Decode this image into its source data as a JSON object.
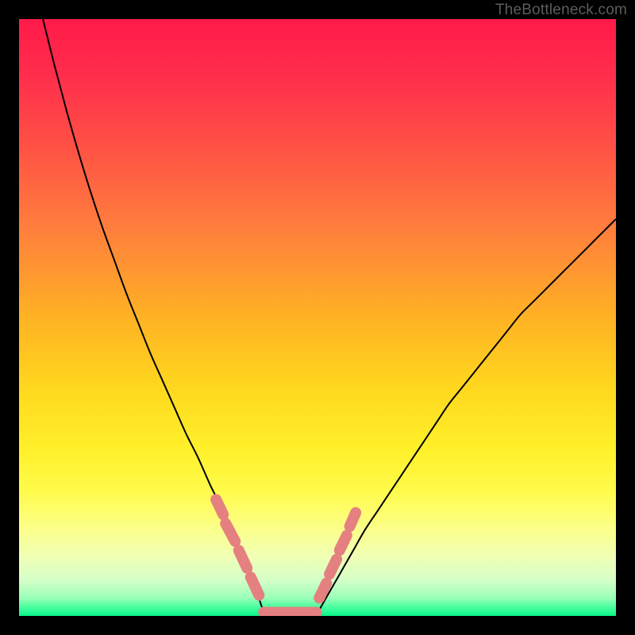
{
  "watermark": "TheBottleneck.com",
  "chart_data": {
    "type": "line",
    "title": "",
    "xlabel": "",
    "ylabel": "",
    "xlim": [
      0,
      100
    ],
    "ylim": [
      0,
      100
    ],
    "grid": false,
    "legend": false,
    "series": [
      {
        "name": "curve-left-branch",
        "stroke": "#000000",
        "stroke_width": 2,
        "x": [
          4,
          6,
          8,
          10,
          12,
          14,
          16,
          18,
          20,
          22,
          24,
          26,
          28,
          30,
          32,
          33,
          34,
          35,
          36,
          37,
          38,
          39,
          40,
          41
        ],
        "y": [
          100,
          92,
          84.5,
          77.5,
          71,
          65,
          59.5,
          54,
          49,
          44,
          39.5,
          35,
          30.5,
          26.5,
          22,
          20,
          18,
          16,
          13.5,
          11,
          8.5,
          6,
          3.5,
          0.5
        ]
      },
      {
        "name": "curve-right-branch",
        "stroke": "#000000",
        "stroke_width": 2,
        "x": [
          50,
          52,
          54,
          56,
          58,
          60,
          62,
          64,
          66,
          68,
          70,
          72,
          74,
          76,
          78,
          80,
          82,
          84,
          86,
          88,
          90,
          92,
          94,
          96,
          98,
          100
        ],
        "y": [
          0.5,
          4,
          7.5,
          11,
          14.5,
          17.5,
          20.5,
          23.5,
          26.5,
          29.5,
          32.5,
          35.5,
          38,
          40.5,
          43,
          45.5,
          48,
          50.5,
          52.5,
          54.5,
          56.5,
          58.5,
          60.5,
          62.5,
          64.5,
          66.5
        ]
      },
      {
        "name": "pink-dashes-left",
        "stroke": "#e58080",
        "stroke_width": 14,
        "linecap": "round",
        "segments": [
          {
            "x1": 33.0,
            "y1": 19.5,
            "x2": 34.2,
            "y2": 17.0
          },
          {
            "x1": 34.6,
            "y1": 15.5,
            "x2": 36.2,
            "y2": 12.5
          },
          {
            "x1": 36.8,
            "y1": 11.0,
            "x2": 38.2,
            "y2": 8.0
          },
          {
            "x1": 38.8,
            "y1": 6.5,
            "x2": 40.2,
            "y2": 3.5
          }
        ]
      },
      {
        "name": "pink-dashes-right",
        "stroke": "#e58080",
        "stroke_width": 14,
        "linecap": "round",
        "segments": [
          {
            "x1": 50.3,
            "y1": 3.0,
            "x2": 51.5,
            "y2": 5.5
          },
          {
            "x1": 52.0,
            "y1": 7.0,
            "x2": 53.2,
            "y2": 9.5
          },
          {
            "x1": 53.7,
            "y1": 11.0,
            "x2": 54.9,
            "y2": 13.5
          },
          {
            "x1": 55.4,
            "y1": 15.0,
            "x2": 56.4,
            "y2": 17.3
          }
        ]
      },
      {
        "name": "pink-flat-bottom",
        "stroke": "#e58080",
        "stroke_width": 14,
        "linecap": "round",
        "segments": [
          {
            "x1": 41.0,
            "y1": 0.6,
            "x2": 49.8,
            "y2": 0.6
          }
        ]
      }
    ],
    "background_gradient": {
      "type": "vertical",
      "stops": [
        {
          "offset": 0.0,
          "color": "#ff1a49"
        },
        {
          "offset": 0.1,
          "color": "#ff2f4c"
        },
        {
          "offset": 0.22,
          "color": "#ff5344"
        },
        {
          "offset": 0.35,
          "color": "#ff7e3d"
        },
        {
          "offset": 0.5,
          "color": "#ffb224"
        },
        {
          "offset": 0.62,
          "color": "#ffd81e"
        },
        {
          "offset": 0.72,
          "color": "#fff02a"
        },
        {
          "offset": 0.79,
          "color": "#fffb4a"
        },
        {
          "offset": 0.85,
          "color": "#fcff86"
        },
        {
          "offset": 0.9,
          "color": "#f0ffb4"
        },
        {
          "offset": 0.94,
          "color": "#d5ffc8"
        },
        {
          "offset": 0.97,
          "color": "#9affb8"
        },
        {
          "offset": 0.985,
          "color": "#4affa0"
        },
        {
          "offset": 1.0,
          "color": "#08f589"
        }
      ]
    }
  }
}
